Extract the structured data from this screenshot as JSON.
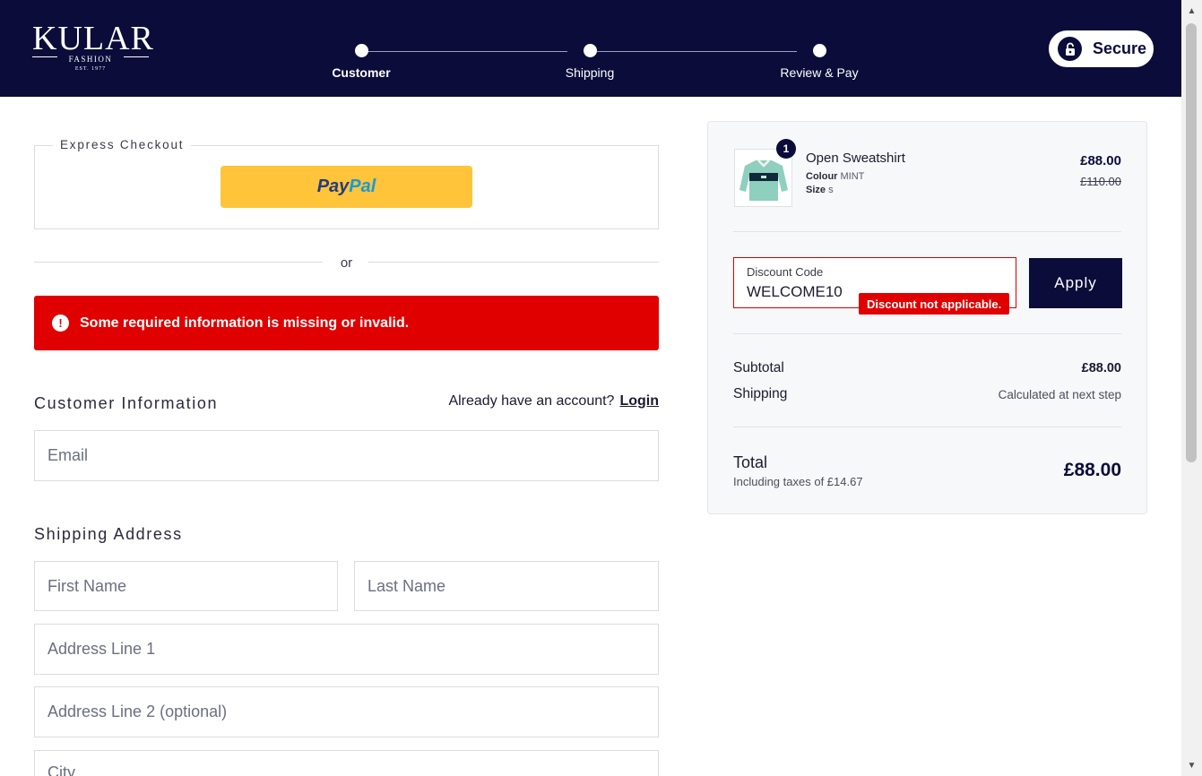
{
  "brand": {
    "name": "KULAR",
    "sub": "FASHION",
    "est": "EST. 1977"
  },
  "steps": [
    "Customer",
    "Shipping",
    "Review & Pay"
  ],
  "secure_label": "Secure",
  "express_checkout": {
    "label": "Express Checkout",
    "paypal_part1": "Pay",
    "paypal_part2": "Pal"
  },
  "or_text": "or",
  "error_banner": {
    "icon": "!",
    "message": "Some required information is missing or invalid."
  },
  "customer_info": {
    "title": "Customer Information",
    "account_prompt": "Already have an account?",
    "login_label": "Login",
    "email_placeholder": "Email"
  },
  "shipping_address": {
    "title": "Shipping Address",
    "first_name_placeholder": "First Name",
    "last_name_placeholder": "Last Name",
    "address1_placeholder": "Address Line 1",
    "address2_placeholder": "Address Line 2 (optional)",
    "city_placeholder": "City"
  },
  "order_summary": {
    "product": {
      "quantity": "1",
      "name": "Open Sweatshirt",
      "colour_label": "Colour",
      "colour_value": "MINT",
      "size_label": "Size",
      "size_value": "s",
      "price": "£88.00",
      "original_price": "£110.00"
    },
    "discount": {
      "label": "Discount Code",
      "value": "WELCOME10",
      "error": "Discount not applicable.",
      "apply_label": "Apply"
    },
    "subtotal_label": "Subtotal",
    "subtotal_value": "£88.00",
    "shipping_label": "Shipping",
    "shipping_value": "Calculated at next step",
    "total_label": "Total",
    "taxes_note": "Including taxes of £14.67",
    "total_value": "£88.00"
  },
  "colors": {
    "navy": "#0b0c3a",
    "error_red": "#e00000",
    "paypal_yellow": "#ffc439"
  }
}
